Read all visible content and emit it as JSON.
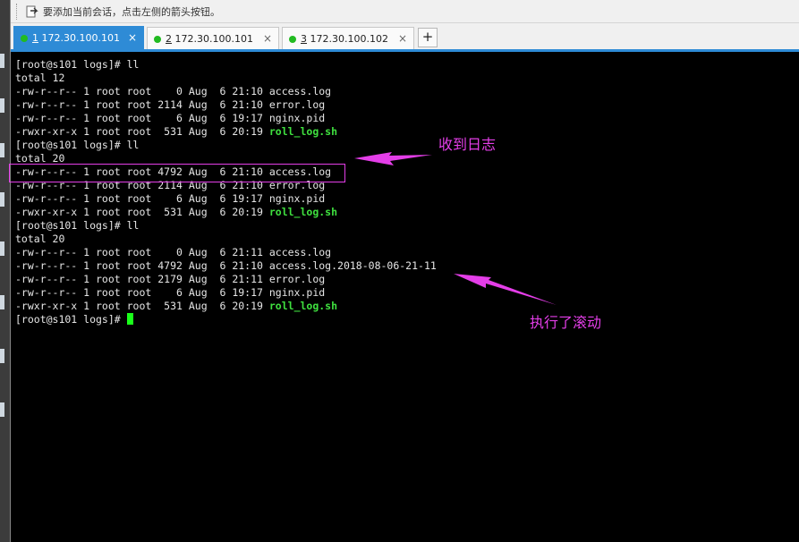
{
  "hint_bar": {
    "text": "要添加当前会话，点击左侧的箭头按钮。"
  },
  "tabs": [
    {
      "index": "1",
      "host": "172.30.100.101",
      "active": true,
      "close": "×"
    },
    {
      "index": "2",
      "host": "172.30.100.101",
      "active": false,
      "close": "×"
    },
    {
      "index": "3",
      "host": "172.30.100.102",
      "active": false,
      "close": "×"
    }
  ],
  "new_tab": {
    "label": "+"
  },
  "terminal": {
    "lines": [
      {
        "text": "[root@s101 logs]# ll"
      },
      {
        "text": "total 12"
      },
      {
        "text": "-rw-r--r-- 1 root root    0 Aug  6 21:10 access.log"
      },
      {
        "text": "-rw-r--r-- 1 root root 2114 Aug  6 21:10 error.log"
      },
      {
        "text": "-rw-r--r-- 1 root root    6 Aug  6 19:17 nginx.pid"
      },
      {
        "text": "-rwxr-xr-x 1 root root  531 Aug  6 20:19 ",
        "script": "roll_log.sh"
      },
      {
        "text": "[root@s101 logs]# ll"
      },
      {
        "text": "total 20"
      },
      {
        "text": "-rw-r--r-- 1 root root 4792 Aug  6 21:10 access.log"
      },
      {
        "text": "-rw-r--r-- 1 root root 2114 Aug  6 21:10 error.log"
      },
      {
        "text": "-rw-r--r-- 1 root root    6 Aug  6 19:17 nginx.pid"
      },
      {
        "text": "-rwxr-xr-x 1 root root  531 Aug  6 20:19 ",
        "script": "roll_log.sh"
      },
      {
        "text": "[root@s101 logs]# ll"
      },
      {
        "text": "total 20"
      },
      {
        "text": "-rw-r--r-- 1 root root    0 Aug  6 21:11 access.log"
      },
      {
        "text": "-rw-r--r-- 1 root root 4792 Aug  6 21:10 access.log.2018-08-06-21-11"
      },
      {
        "text": "-rw-r--r-- 1 root root 2179 Aug  6 21:11 error.log"
      },
      {
        "text": "-rw-r--r-- 1 root root    6 Aug  6 19:17 nginx.pid"
      },
      {
        "text": "-rwxr-xr-x 1 root root  531 Aug  6 20:19 ",
        "script": "roll_log.sh"
      },
      {
        "text": "[root@s101 logs]# ",
        "cursor": true
      }
    ]
  },
  "annotations": {
    "received_log": "收到日志",
    "rolled": "执行了滚动"
  },
  "colors": {
    "accent_tab": "#2e8bd6",
    "annotation": "#e43ee8",
    "script_name": "#3fe03f",
    "cursor": "#1aff1a",
    "status_dot": "#22bb22"
  }
}
